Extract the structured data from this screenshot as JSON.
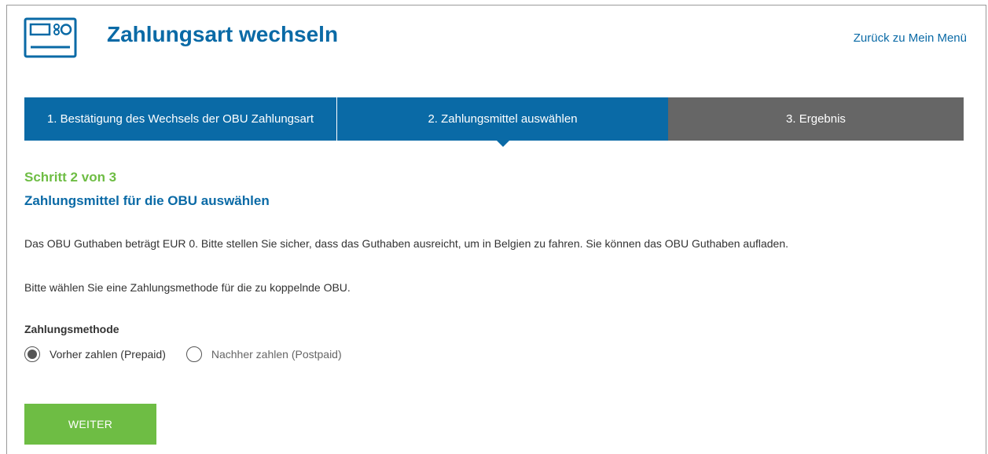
{
  "header": {
    "title": "Zahlungsart wechseln",
    "back_link": "Zurück zu Mein Menü",
    "icon": "obu-device-icon"
  },
  "steps": [
    {
      "label": "1. Bestätigung des Wechsels der OBU Zahlungsart",
      "state": "completed"
    },
    {
      "label": "2. Zahlungsmittel auswählen",
      "state": "active"
    },
    {
      "label": "3. Ergebnis",
      "state": "upcoming"
    }
  ],
  "main": {
    "step_indicator": "Schritt 2 von 3",
    "section_title": "Zahlungsmittel für die OBU auswählen",
    "info_text": "Das OBU Guthaben beträgt EUR 0. Bitte stellen Sie sicher, dass das Guthaben ausreicht, um in Belgien zu fahren. Sie können das OBU Guthaben aufladen.",
    "instruction_text": "Bitte wählen Sie eine Zahlungsmethode für die zu koppelnde OBU.",
    "method_label": "Zahlungsmethode",
    "options": [
      {
        "label": "Vorher zahlen (Prepaid)",
        "selected": true
      },
      {
        "label": "Nachher zahlen (Postpaid)",
        "selected": false
      }
    ],
    "submit_label": "WEITER"
  },
  "colors": {
    "primary_blue": "#0a6aa6",
    "accent_green": "#6ebd44",
    "inactive_gray": "#666666"
  }
}
